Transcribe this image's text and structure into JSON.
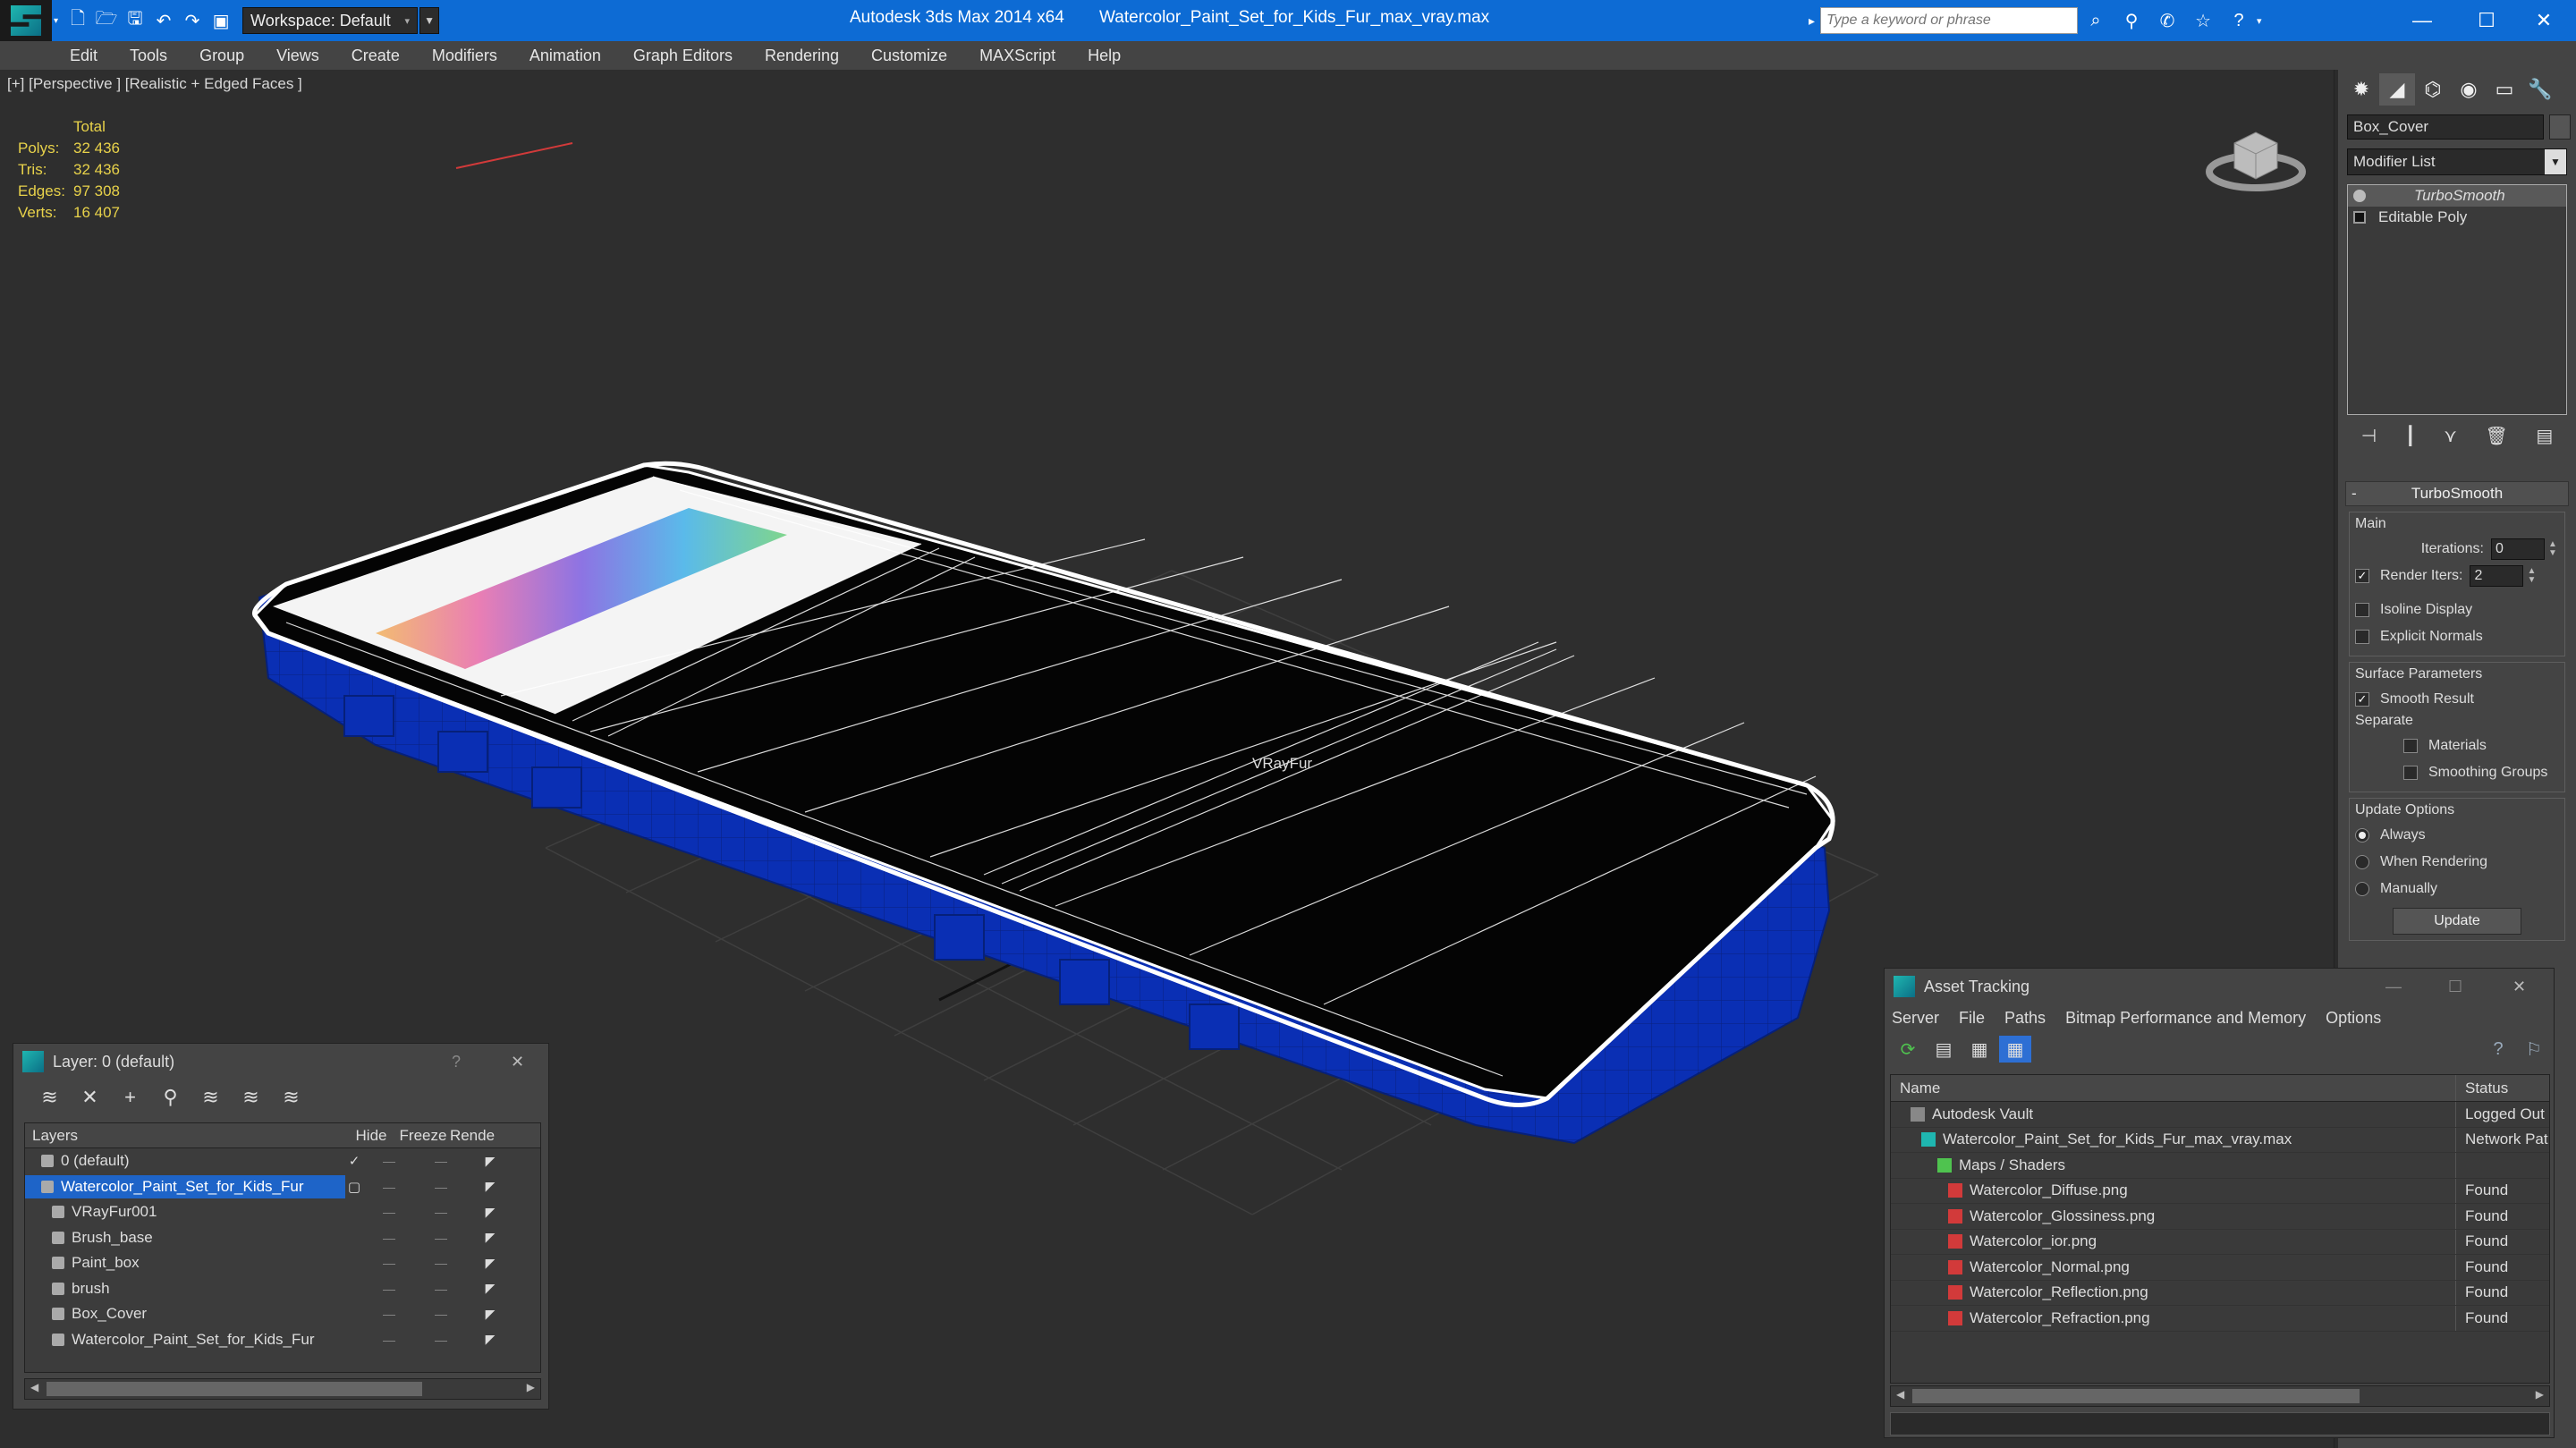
{
  "titlebar": {
    "workspace_label": "Workspace: Default",
    "app_name": "Autodesk 3ds Max  2014 x64",
    "file_name": "Watercolor_Paint_Set_for_Kids_Fur_max_vray.max",
    "search_placeholder": "Type a keyword or phrase"
  },
  "menu": [
    "Edit",
    "Tools",
    "Group",
    "Views",
    "Create",
    "Modifiers",
    "Animation",
    "Graph Editors",
    "Rendering",
    "Customize",
    "MAXScript",
    "Help"
  ],
  "viewport": {
    "label": "[+] [Perspective ] [Realistic + Edged Faces ]",
    "stats_header": "Total",
    "stats": [
      {
        "k": "Polys:",
        "v": "32 436"
      },
      {
        "k": "Tris:",
        "v": "32 436"
      },
      {
        "k": "Edges:",
        "v": "97 308"
      },
      {
        "k": "Verts:",
        "v": "16 407"
      }
    ],
    "object_label": "VRayFur"
  },
  "command_panel": {
    "object_name": "Box_Cover",
    "modifier_list": "Modifier List",
    "stack": [
      {
        "label": "TurboSmooth",
        "selected": true
      },
      {
        "label": "Editable Poly",
        "selected": false
      }
    ],
    "rollout_title": "TurboSmooth",
    "main_group": "Main",
    "iterations_label": "Iterations:",
    "iterations_value": "0",
    "render_iters_label": "Render Iters:",
    "render_iters_value": "2",
    "isoline_label": "Isoline Display",
    "explicit_normals_label": "Explicit Normals",
    "surface_group": "Surface Parameters",
    "smooth_result_label": "Smooth Result",
    "separate_label": "Separate",
    "materials_label": "Materials",
    "smoothing_groups_label": "Smoothing Groups",
    "update_group": "Update Options",
    "always_label": "Always",
    "when_rendering_label": "When Rendering",
    "manually_label": "Manually",
    "update_button": "Update"
  },
  "layer_panel": {
    "title": "Layer: 0 (default)",
    "columns": [
      "Layers",
      "Hide",
      "Freeze",
      "Rende"
    ],
    "rows": [
      {
        "name": "0 (default)",
        "level": 1,
        "selected": false
      },
      {
        "name": "Watercolor_Paint_Set_for_Kids_Fur",
        "level": 1,
        "selected": true
      },
      {
        "name": "VRayFur001",
        "level": 2,
        "selected": false
      },
      {
        "name": "Brush_base",
        "level": 2,
        "selected": false
      },
      {
        "name": "Paint_box",
        "level": 2,
        "selected": false
      },
      {
        "name": "brush",
        "level": 2,
        "selected": false
      },
      {
        "name": "Box_Cover",
        "level": 2,
        "selected": false
      },
      {
        "name": "Watercolor_Paint_Set_for_Kids_Fur",
        "level": 2,
        "selected": false
      }
    ]
  },
  "asset_panel": {
    "title": "Asset Tracking",
    "menu": [
      "Server",
      "File",
      "Paths",
      "Bitmap Performance and Memory",
      "Options"
    ],
    "col_name": "Name",
    "col_status": "Status",
    "rows": [
      {
        "name": "Autodesk Vault",
        "status": "Logged Out",
        "level": 1,
        "icon": "vault"
      },
      {
        "name": "Watercolor_Paint_Set_for_Kids_Fur_max_vray.max",
        "status": "Network Pat",
        "level": 2,
        "icon": "max"
      },
      {
        "name": "Maps / Shaders",
        "status": "",
        "level": 3,
        "icon": "maps"
      },
      {
        "name": "Watercolor_Diffuse.png",
        "status": "Found",
        "level": 4,
        "icon": "png"
      },
      {
        "name": "Watercolor_Glossiness.png",
        "status": "Found",
        "level": 4,
        "icon": "png"
      },
      {
        "name": "Watercolor_ior.png",
        "status": "Found",
        "level": 4,
        "icon": "png"
      },
      {
        "name": "Watercolor_Normal.png",
        "status": "Found",
        "level": 4,
        "icon": "png"
      },
      {
        "name": "Watercolor_Reflection.png",
        "status": "Found",
        "level": 4,
        "icon": "png"
      },
      {
        "name": "Watercolor_Refraction.png",
        "status": "Found",
        "level": 4,
        "icon": "png"
      }
    ]
  },
  "colors": {
    "titlebar": "#0d6bd4",
    "selection": "#1e64c8",
    "stats_text": "#e8d24a",
    "box_blue": "#0a2fb4"
  }
}
